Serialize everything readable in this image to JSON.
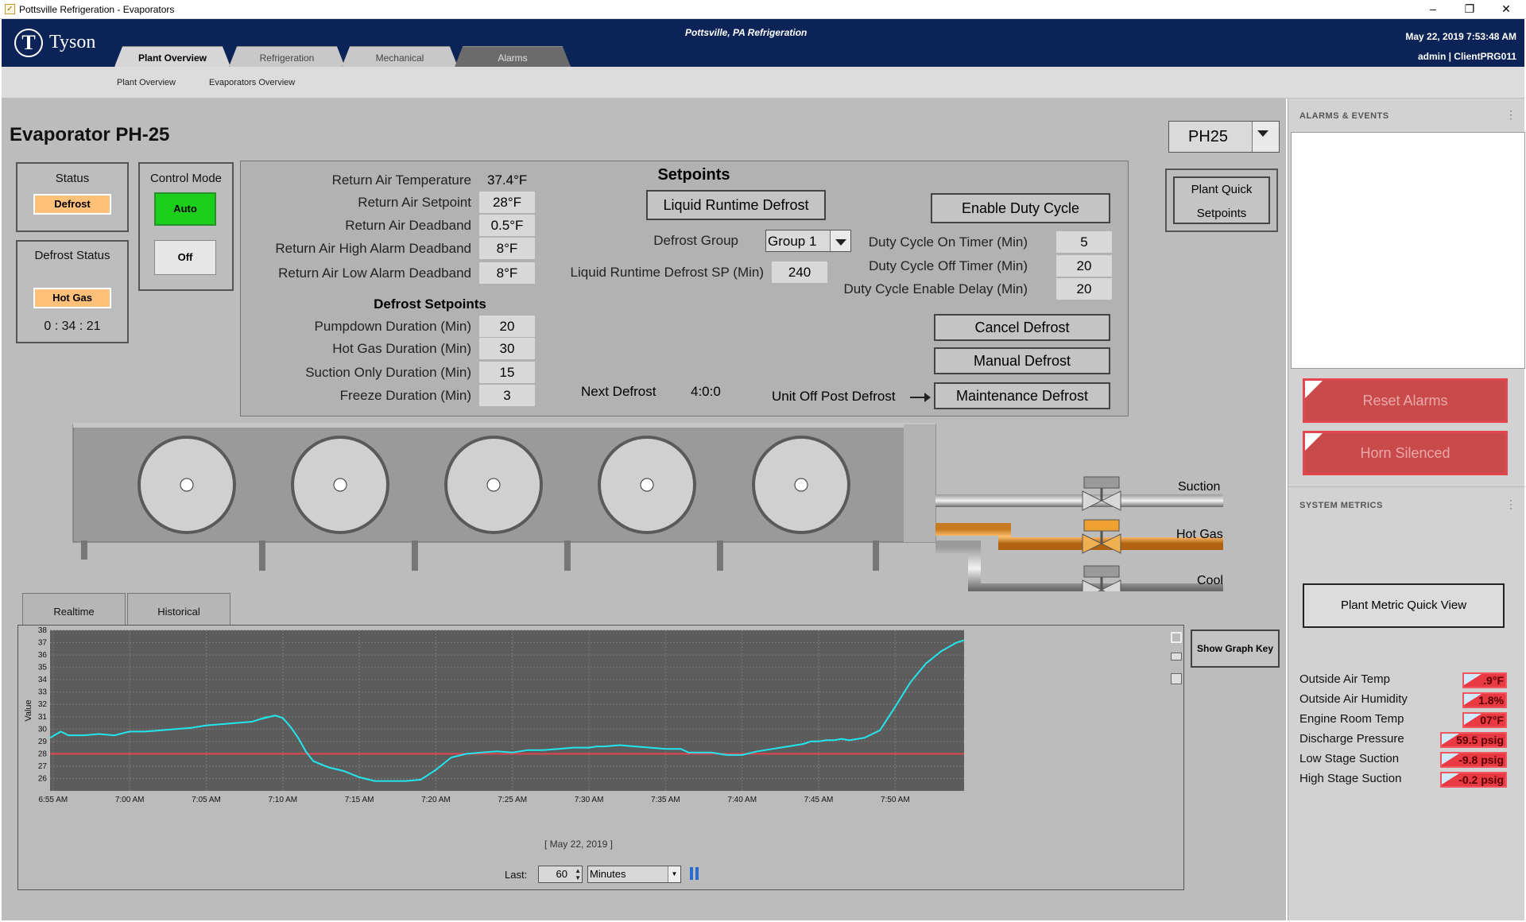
{
  "window": {
    "title": "Pottsville Refrigeration - Evaporators",
    "min": "–",
    "restore": "❐",
    "close": "✕"
  },
  "header": {
    "brand": "Tyson",
    "brand_mark": "T",
    "site": "Pottsville, PA Refrigeration",
    "datetime": "May 22, 2019 7:53:48 AM",
    "user": "admin | ClientPRG011",
    "tabs": [
      {
        "label": "Plant Overview"
      },
      {
        "label": "Refrigeration"
      },
      {
        "label": "Mechanical"
      },
      {
        "label": "Alarms"
      }
    ]
  },
  "subnav": {
    "items": [
      {
        "label": "Plant Overview"
      },
      {
        "label": "Evaporators Overview"
      }
    ]
  },
  "page": {
    "title": "Evaporator PH-25",
    "unit_select": "PH25"
  },
  "status": {
    "label": "Status",
    "value": "Defrost"
  },
  "defrost_status": {
    "label": "Defrost Status",
    "value": "Hot Gas",
    "timer": "0 : 34 : 21"
  },
  "control_mode": {
    "label": "Control Mode",
    "auto": "Auto",
    "off": "Off"
  },
  "quick_setpoints": "Plant Quick Setpoints",
  "readings": [
    {
      "label": "Return Air Temperature",
      "value": "37.4°F"
    },
    {
      "label": "Return Air Setpoint",
      "value": "28°F"
    },
    {
      "label": "Return Air Deadband",
      "value": "0.5°F"
    },
    {
      "label": "Return Air High Alarm Deadband",
      "value": "8°F"
    },
    {
      "label": "Return Air Low Alarm Deadband",
      "value": "8°F"
    }
  ],
  "defrost_setpoints": {
    "title": "Defrost Setpoints",
    "items": [
      {
        "label": "Pumpdown Duration (Min)",
        "value": "20"
      },
      {
        "label": "Hot Gas Duration (Min)",
        "value": "30"
      },
      {
        "label": "Suction Only Duration (Min)",
        "value": "15"
      },
      {
        "label": "Freeze Duration (Min)",
        "value": "3"
      }
    ]
  },
  "setpoints": {
    "title": "Setpoints",
    "liquid_runtime_button": "Liquid Runtime Defrost",
    "defrost_group_label": "Defrost Group",
    "defrost_group_value": "Group 1",
    "liquid_runtime_sp_label": "Liquid Runtime Defrost SP (Min)",
    "liquid_runtime_sp_value": "240",
    "next_defrost_label": "Next Defrost",
    "next_defrost_value": "4:0:0",
    "unit_off_label": "Unit Off Post Defrost",
    "enable_duty_cycle": "Enable Duty Cycle",
    "duty": [
      {
        "label": "Duty Cycle On Timer (Min)",
        "value": "5"
      },
      {
        "label": "Duty Cycle Off Timer (Min)",
        "value": "20"
      },
      {
        "label": "Duty Cycle Enable Delay (Min)",
        "value": "20"
      }
    ],
    "cancel_defrost": "Cancel Defrost",
    "manual_defrost": "Manual Defrost",
    "maintenance_defrost": "Maintenance Defrost"
  },
  "pipes": {
    "suction": "Suction",
    "hot_gas": "Hot Gas",
    "cool": "Cool",
    "hot_gas_color": "#f0a030"
  },
  "graph_tabs": {
    "realtime": "Realtime",
    "historical": "Historical"
  },
  "graph": {
    "show_key": "Show Graph Key",
    "date": "[ May 22, 2019 ]",
    "last_label": "Last:",
    "last_value": "60",
    "unit": "Minutes"
  },
  "chart_data": {
    "type": "line",
    "ylabel": "Value",
    "xlabel": "",
    "ylim": [
      25,
      38
    ],
    "yticks": [
      26,
      27,
      28,
      29,
      30,
      31,
      32,
      33,
      34,
      35,
      36,
      37,
      38
    ],
    "xticks": [
      "6:55 AM",
      "7:00 AM",
      "7:05 AM",
      "7:10 AM",
      "7:15 AM",
      "7:20 AM",
      "7:25 AM",
      "7:30 AM",
      "7:35 AM",
      "7:40 AM",
      "7:45 AM",
      "7:50 AM"
    ],
    "xrange_min": [
      -0.2,
      59.5
    ],
    "grid": true,
    "series": [
      {
        "color": "#22e6ee",
        "x": [
          -0.2,
          0.5,
          1,
          2,
          3,
          4,
          5,
          6,
          7,
          8,
          9,
          10,
          11,
          12,
          13,
          14,
          13.5,
          14.5,
          15,
          15.5,
          16,
          16.5,
          17,
          18,
          19,
          20,
          21,
          22,
          23,
          24,
          25,
          26,
          27,
          28,
          29,
          30,
          31,
          32,
          33,
          34,
          35,
          35.5,
          36,
          37,
          38,
          39,
          40,
          41,
          41.5,
          42,
          43,
          44,
          45,
          46,
          47,
          48,
          49,
          49.5,
          50,
          50.5,
          51,
          51.5,
          52,
          53,
          54,
          55,
          56,
          57,
          58,
          59,
          59.5
        ],
        "y": [
          29.3,
          29.8,
          29.5,
          29.5,
          29.6,
          29.5,
          29.8,
          29.8,
          29.9,
          30.0,
          30.1,
          30.3,
          30.4,
          30.5,
          30.6,
          31.0,
          30.8,
          31.1,
          30.9,
          30.2,
          29.3,
          28.2,
          27.4,
          26.9,
          26.6,
          26.1,
          25.8,
          25.8,
          25.8,
          25.9,
          26.7,
          27.7,
          28.0,
          28.1,
          28.2,
          28.1,
          28.3,
          28.3,
          28.4,
          28.5,
          28.5,
          28.6,
          28.6,
          28.7,
          28.6,
          28.5,
          28.4,
          28.4,
          28.1,
          28.1,
          28.1,
          27.9,
          27.9,
          28.2,
          28.4,
          28.6,
          28.8,
          29.0,
          29.0,
          29.1,
          29.1,
          29.2,
          29.1,
          29.3,
          29.9,
          31.8,
          33.8,
          35.3,
          36.3,
          37.0,
          37.2
        ]
      },
      {
        "color": "#e0444c",
        "x": [
          -0.2,
          59.5
        ],
        "y": [
          28,
          28
        ]
      }
    ]
  },
  "sidebar": {
    "alarms_title": "ALARMS & EVENTS",
    "reset_alarms": "Reset Alarms",
    "horn_silenced": "Horn Silenced",
    "metrics_title": "SYSTEM METRICS",
    "quick_view": "Plant Metric Quick View",
    "metrics": [
      {
        "label": "Outside Air Temp",
        "value": ".9°F"
      },
      {
        "label": "Outside Air Humidity",
        "value": "1.8%"
      },
      {
        "label": "Engine Room Temp",
        "value": "07°F"
      },
      {
        "label": "Discharge Pressure",
        "value": "59.5 psig"
      },
      {
        "label": "Low Stage Suction",
        "value": "-9.8 psig"
      },
      {
        "label": "High Stage Suction",
        "value": "-0.2 psig"
      }
    ]
  }
}
